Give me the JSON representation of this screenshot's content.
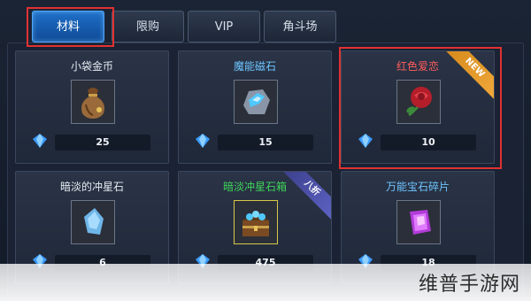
{
  "tabs": [
    {
      "label": "材料",
      "active": true
    },
    {
      "label": "限购",
      "active": false
    },
    {
      "label": "VIP",
      "active": false
    },
    {
      "label": "角斗场",
      "active": false
    }
  ],
  "items": [
    {
      "name": "小袋金币",
      "price": "25",
      "name_color": "#e6ebf2",
      "icon": "gold-coin-bag-icon"
    },
    {
      "name": "魔能磁石",
      "price": "15",
      "name_color": "#6fc4ff",
      "icon": "magnetic-stone-icon"
    },
    {
      "name": "红色爱恋",
      "price": "10",
      "name_color": "#ff5b5b",
      "icon": "red-rose-icon",
      "badge": "NEW"
    },
    {
      "name": "暗淡的冲星石",
      "price": "6",
      "name_color": "#e6ebf2",
      "icon": "dim-star-stone-icon"
    },
    {
      "name": "暗淡冲星石箱",
      "price": "475",
      "name_color": "#3fd35a",
      "icon": "treasure-chest-icon",
      "badge": "八折"
    },
    {
      "name": "万能宝石碎片",
      "price": "18",
      "name_color": "#6fc4ff",
      "icon": "purple-gem-shard-icon"
    }
  ],
  "watermark": "维普手游网",
  "colors": {
    "accent": "#1f6fc8",
    "highlight": "#e03232"
  }
}
